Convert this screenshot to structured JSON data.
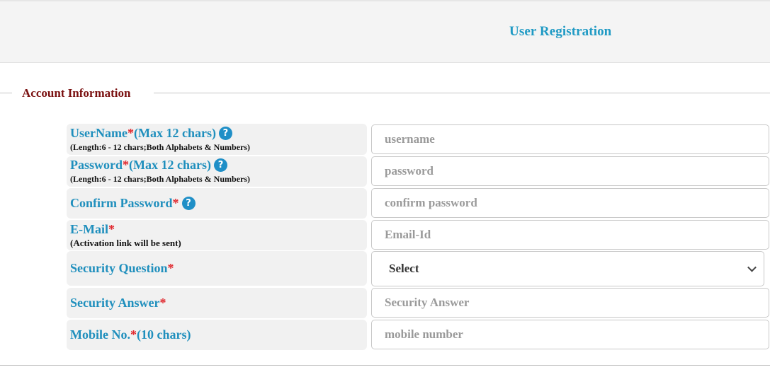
{
  "header": {
    "title": "User Registration"
  },
  "section": {
    "legend": "Account Information"
  },
  "fields": [
    {
      "label": "UserName ",
      "required": "*",
      "label_suffix": "(Max 12 chars)",
      "hint": "(Length:6 - 12 chars;Both Alphabets & Numbers)",
      "help_icon": "question-circle-icon",
      "placeholder": "username",
      "type": "text"
    },
    {
      "label": "Password",
      "required": "*",
      "label_suffix": " (Max 12 chars)",
      "hint": "(Length:6 - 12 chars;Both Alphabets & Numbers)",
      "help_icon": "question-circle-icon",
      "placeholder": "password",
      "type": "password"
    },
    {
      "label": "Confirm Password",
      "required": "*",
      "label_suffix": "",
      "hint": "",
      "help_icon": "question-circle-icon",
      "placeholder": "confirm password",
      "type": "password"
    },
    {
      "label": "E-Mail",
      "required": "*",
      "label_suffix": "",
      "hint": "(Activation link will be sent)",
      "placeholder": "Email-Id",
      "type": "email"
    },
    {
      "label": "Security Question",
      "required": "*",
      "label_suffix": "",
      "hint": "",
      "type": "select",
      "selected": "Select"
    },
    {
      "label": "Security Answer",
      "required": "*",
      "label_suffix": "",
      "hint": "",
      "placeholder": "Security Answer",
      "type": "text"
    },
    {
      "label": "Mobile No.",
      "required": "*",
      "label_suffix": " (10 chars)",
      "hint": "",
      "placeholder": "mobile number",
      "type": "tel"
    }
  ],
  "help_icon_glyph": "?",
  "colors": {
    "label": "#1f8fbd",
    "required": "#e0262c",
    "legend": "#7a1010",
    "title": "#1f9ac4",
    "help_icon_bg": "#1f8fc7"
  }
}
